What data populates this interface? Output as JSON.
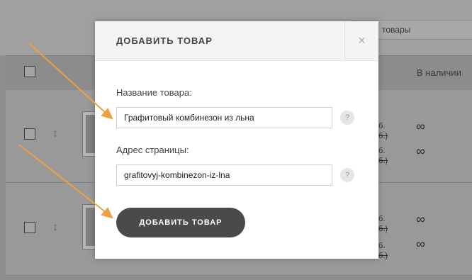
{
  "background": {
    "search_text": "товары",
    "column_in_stock": "В наличии",
    "rows": [
      {
        "prices": [
          {
            "current": "б.",
            "old": "б.)"
          },
          {
            "current": "б.",
            "old": "б.)"
          }
        ],
        "stock": [
          "∞",
          "∞"
        ]
      },
      {
        "prices": [
          {
            "current": "б.",
            "old": "б.)"
          },
          {
            "current": "б.",
            "old": "б.)"
          }
        ],
        "stock": [
          "∞",
          "∞"
        ]
      }
    ],
    "drag_glyph": "↕"
  },
  "modal": {
    "title": "ДОБАВИТЬ ТОВАР",
    "close_glyph": "×",
    "fields": {
      "name": {
        "label": "Название товара:",
        "value": "Графитовый комбинезон из льна",
        "help": "?"
      },
      "url": {
        "label": "Адрес страницы:",
        "value": "grafitovyj-kombinezon-iz-lna",
        "help": "?"
      }
    },
    "submit_label": "ДОБАВИТЬ ТОВАР"
  },
  "colors": {
    "overlay": "#8f8f8f",
    "button": "#4a4a4a",
    "annotation_arrow": "#f0a040"
  }
}
